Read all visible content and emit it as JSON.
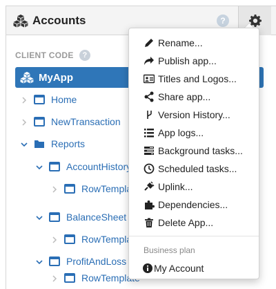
{
  "header": {
    "title": "Accounts",
    "help": "?"
  },
  "section": {
    "label": "CLIENT CODE",
    "help": "?"
  },
  "tree": {
    "root": "MyApp",
    "items": [
      {
        "label": "Home"
      },
      {
        "label": "NewTransaction"
      },
      {
        "label": "Reports"
      },
      {
        "label": "AccountHistory"
      },
      {
        "label": "RowTemplate"
      },
      {
        "label": "BalanceSheet"
      },
      {
        "label": "RowTemplate"
      },
      {
        "label": "ProfitAndLoss"
      },
      {
        "label": "RowTemplate"
      }
    ]
  },
  "menu": {
    "items": [
      {
        "label": "Rename...",
        "icon": "pencil-icon"
      },
      {
        "label": "Publish app...",
        "icon": "share-arrow-icon"
      },
      {
        "label": "Titles and Logos...",
        "icon": "id-card-icon"
      },
      {
        "label": "Share app...",
        "icon": "share-icon"
      },
      {
        "label": "Version History...",
        "icon": "branch-icon"
      },
      {
        "label": "App logs...",
        "icon": "list-icon"
      },
      {
        "label": "Background tasks...",
        "icon": "tasks-icon"
      },
      {
        "label": "Scheduled tasks...",
        "icon": "clock-icon"
      },
      {
        "label": "Uplink...",
        "icon": "plug-icon"
      },
      {
        "label": "Dependencies...",
        "icon": "puzzle-icon"
      },
      {
        "label": "Delete App...",
        "icon": "trash-icon"
      }
    ],
    "plan_header": "Business plan",
    "account": {
      "label": "My Account",
      "icon": "info-icon"
    }
  },
  "colors": {
    "accent": "#2f76b8",
    "link": "#2a6eb5",
    "header_bg": "#f4f4f4"
  }
}
